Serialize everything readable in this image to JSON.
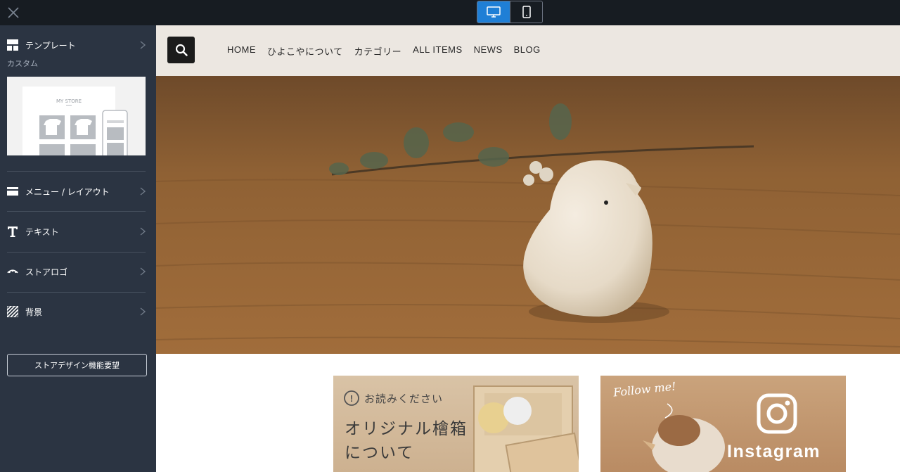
{
  "editor": {
    "device_modes": [
      "desktop-icon",
      "mobile-icon"
    ],
    "active_device": "desktop",
    "accent_color": "#1f7fd6"
  },
  "sidebar": {
    "template": {
      "label": "テンプレート",
      "sub": "カスタム",
      "thumb_text": "MY STORE"
    },
    "items": [
      {
        "label": "メニュー / レイアウト",
        "icon": "menu-layout-icon"
      },
      {
        "label": "テキスト",
        "icon": "text-icon"
      },
      {
        "label": "ストアロゴ",
        "icon": "logo-icon"
      },
      {
        "label": "背景",
        "icon": "background-icon"
      }
    ],
    "request_button": "ストアデザイン機能要望"
  },
  "site": {
    "nav": [
      "HOME",
      "ひよこやについて",
      "カテゴリー",
      "ALL ITEMS",
      "NEWS",
      "BLOG"
    ],
    "banner1": {
      "note": "お読みください",
      "title_line1": "オリジナル檜箱",
      "title_line2": "について"
    },
    "banner2": {
      "caption": "Follow me!",
      "label": "Instagram"
    }
  }
}
